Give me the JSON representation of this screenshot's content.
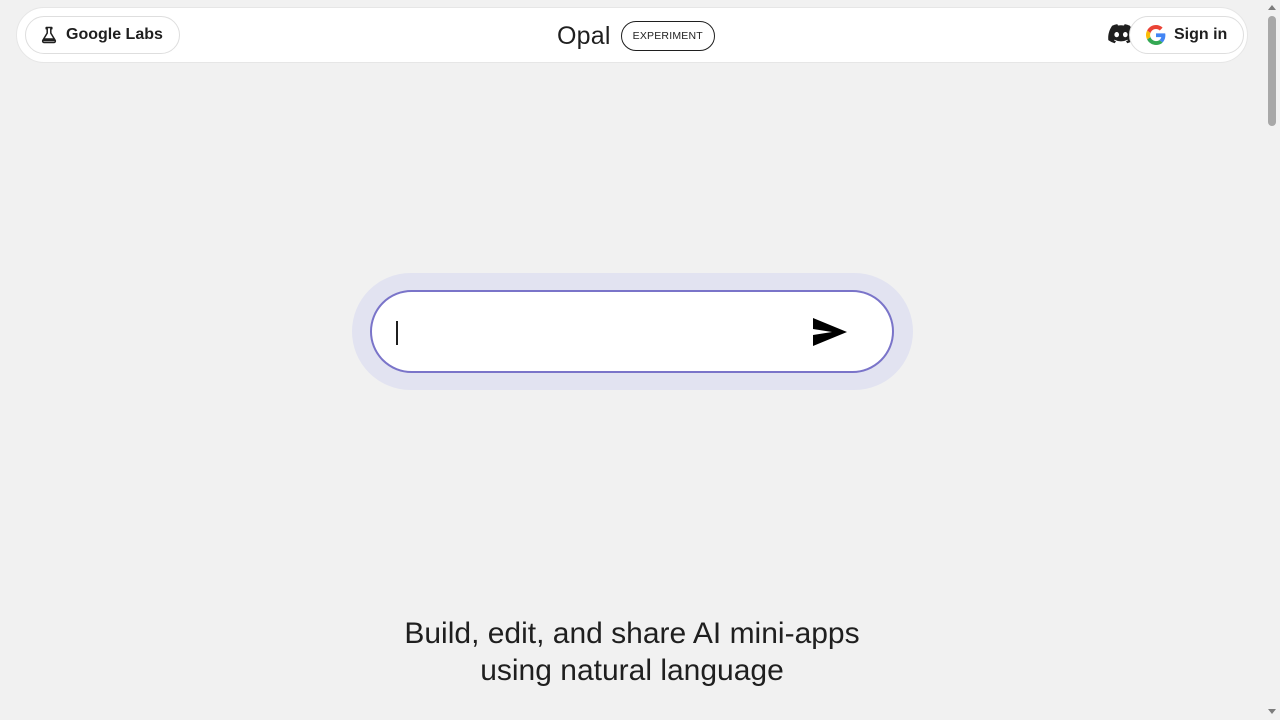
{
  "header": {
    "labs_label": "Google Labs",
    "brand_title": "Opal",
    "badge": "EXPERIMENT",
    "signin_label": "Sign in",
    "icons": {
      "labs": "flask-icon",
      "discord": "discord-icon",
      "google": "google-g-icon"
    }
  },
  "prompt": {
    "value": "",
    "placeholder": "",
    "send_icon": "send-icon"
  },
  "tagline": {
    "line1": "Build, edit, and share AI mini-apps",
    "line2": "using natural language"
  },
  "colors": {
    "background": "#f1f1f1",
    "prompt_border": "#7a74c9",
    "prompt_halo": "#e2e3f1"
  }
}
